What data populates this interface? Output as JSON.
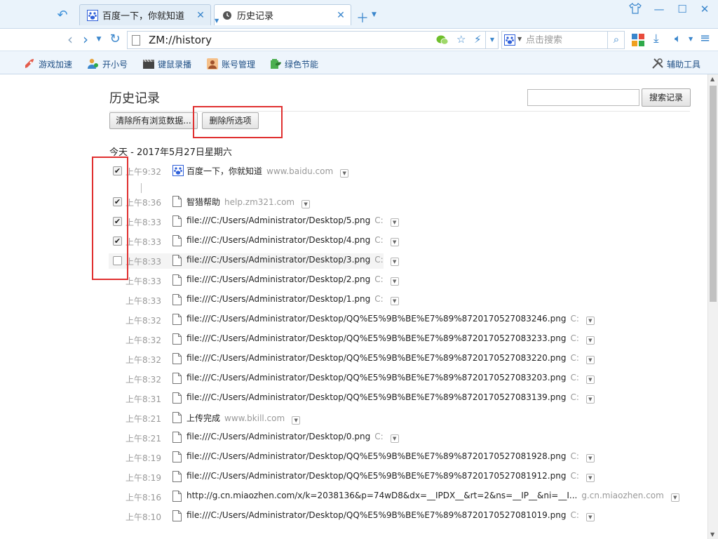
{
  "tabs": [
    {
      "label": "百度一下，你就知道",
      "icon": "baidu-paw-icon"
    },
    {
      "label": "历史记录",
      "icon": "clock-icon"
    }
  ],
  "nav": {
    "address": "ZM://history",
    "search_placeholder": "点击搜索"
  },
  "toolbar": {
    "game": "游戏加速",
    "multi": "开小号",
    "record": "键鼠录播",
    "account": "账号管理",
    "eco": "绿色节能",
    "tools": "辅助工具"
  },
  "page": {
    "title": "历史记录",
    "search_button": "搜索记录",
    "clear_button": "清除所有浏览数据...",
    "delete_button": "删除所选项",
    "date_header": "今天 - 2017年5月27日星期六"
  },
  "rows": [
    {
      "time": "上午9:32",
      "title": "百度一下，你就知道",
      "domain": "www.baidu.com",
      "checked": true,
      "icon": "baidu-paw-icon"
    },
    {
      "time": "上午8:36",
      "title": "智猎帮助",
      "domain": "help.zm321.com",
      "checked": true,
      "icon": "page-icon"
    },
    {
      "time": "上午8:33",
      "title": "file:///C:/Users/Administrator/Desktop/5.png",
      "domain": "C:",
      "checked": true,
      "icon": "page-icon"
    },
    {
      "time": "上午8:33",
      "title": "file:///C:/Users/Administrator/Desktop/4.png",
      "domain": "C:",
      "checked": true,
      "icon": "page-icon"
    },
    {
      "time": "上午8:33",
      "title": "file:///C:/Users/Administrator/Desktop/3.png",
      "domain": "C:",
      "checked": false,
      "icon": "page-icon"
    },
    {
      "time": "上午8:33",
      "title": "file:///C:/Users/Administrator/Desktop/2.png",
      "domain": "C:",
      "icon": "page-icon"
    },
    {
      "time": "上午8:33",
      "title": "file:///C:/Users/Administrator/Desktop/1.png",
      "domain": "C:",
      "icon": "page-icon"
    },
    {
      "time": "上午8:32",
      "title": "file:///C:/Users/Administrator/Desktop/QQ%E5%9B%BE%E7%89%8720170527083246.png",
      "domain": "C:",
      "icon": "page-icon"
    },
    {
      "time": "上午8:32",
      "title": "file:///C:/Users/Administrator/Desktop/QQ%E5%9B%BE%E7%89%8720170527083233.png",
      "domain": "C:",
      "icon": "page-icon"
    },
    {
      "time": "上午8:32",
      "title": "file:///C:/Users/Administrator/Desktop/QQ%E5%9B%BE%E7%89%8720170527083220.png",
      "domain": "C:",
      "icon": "page-icon"
    },
    {
      "time": "上午8:32",
      "title": "file:///C:/Users/Administrator/Desktop/QQ%E5%9B%BE%E7%89%8720170527083203.png",
      "domain": "C:",
      "icon": "page-icon"
    },
    {
      "time": "上午8:31",
      "title": "file:///C:/Users/Administrator/Desktop/QQ%E5%9B%BE%E7%89%8720170527083139.png",
      "domain": "C:",
      "icon": "page-icon"
    },
    {
      "time": "上午8:21",
      "title": "上传完成",
      "domain": "www.bkill.com",
      "icon": "page-icon"
    },
    {
      "time": "上午8:21",
      "title": "file:///C:/Users/Administrator/Desktop/0.png",
      "domain": "C:",
      "icon": "page-icon"
    },
    {
      "time": "上午8:19",
      "title": "file:///C:/Users/Administrator/Desktop/QQ%E5%9B%BE%E7%89%8720170527081928.png",
      "domain": "C:",
      "icon": "page-icon"
    },
    {
      "time": "上午8:19",
      "title": "file:///C:/Users/Administrator/Desktop/QQ%E5%9B%BE%E7%89%8720170527081912.png",
      "domain": "C:",
      "icon": "page-icon"
    },
    {
      "time": "上午8:16",
      "title": "http://g.cn.miaozhen.com/x/k=2038136&p=74wD8&dx=__IPDX__&rt=2&ns=__IP__&ni=__I...",
      "domain": "g.cn.miaozhen.com",
      "icon": "page-icon"
    },
    {
      "time": "上午8:10",
      "title": "file:///C:/Users/Administrator/Desktop/QQ%E5%9B%BE%E7%89%8720170527081019.png",
      "domain": "C:",
      "icon": "page-icon"
    }
  ],
  "colors": {
    "accent": "#3a86cc",
    "highlight_box": "#e03030"
  }
}
